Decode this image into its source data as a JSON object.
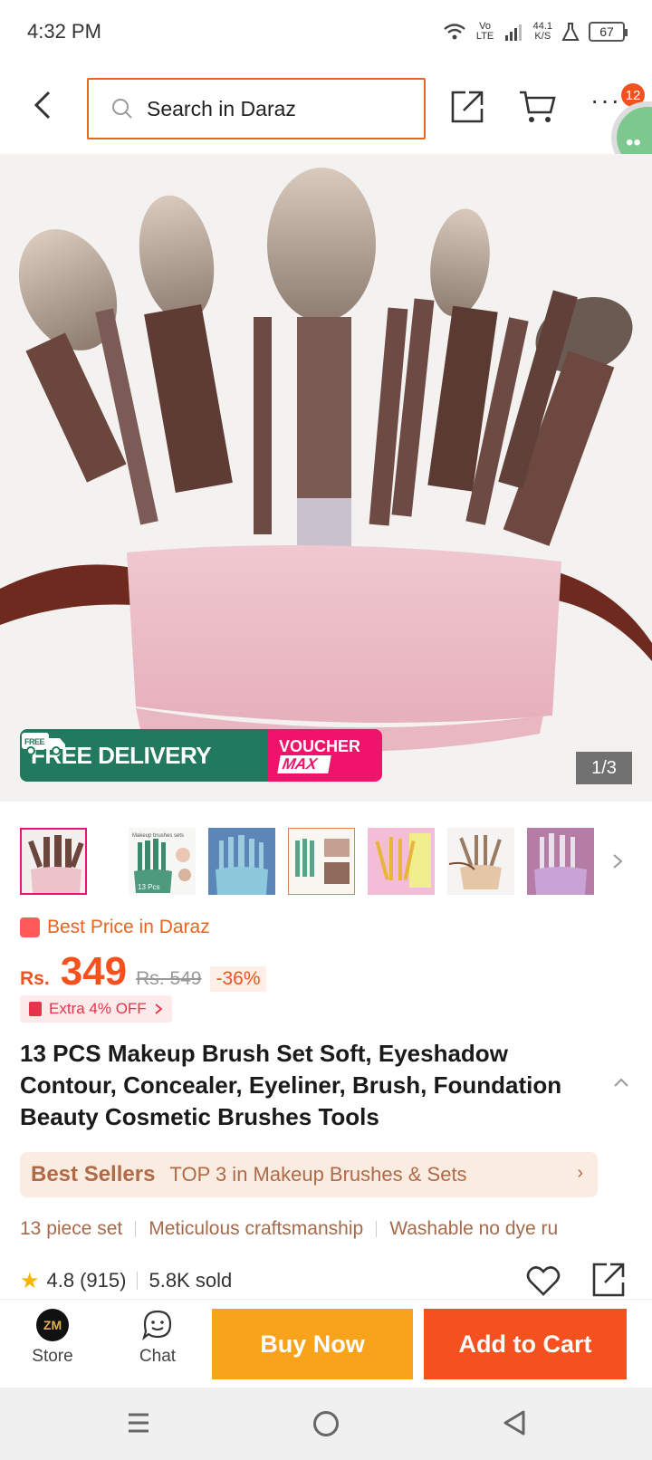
{
  "status_bar": {
    "time": "4:32 PM",
    "network_label": "Vo LTE",
    "speed": "44.1",
    "speed_unit": "K/S",
    "battery": "67"
  },
  "top_nav": {
    "search_placeholder": "Search in Daraz",
    "cart_badge": "12",
    "more_label": "···"
  },
  "hero": {
    "promo_free": "FREE DELIVERY",
    "promo_free_tag": "FREE",
    "promo_voucher": "VOUCHER",
    "promo_voucher_max": "MAX",
    "page_indicator": "1/3"
  },
  "thumbnails": {
    "count": 7,
    "active_index": 0,
    "thumb_2_caption": "Makeup brushes sets",
    "thumb_2_badge": "13 Pcs"
  },
  "price": {
    "best_price_label": "Best Price in Daraz",
    "currency": "Rs.",
    "current": "349",
    "original": "Rs. 549",
    "discount": "-36%",
    "extra_off": "Extra 4% OFF"
  },
  "product": {
    "title": "13 PCS Makeup Brush Set Soft, Eyeshadow Contour, Concealer, Eyeliner, Brush, Foundation Beauty Cosmetic Brushes Tools"
  },
  "best_sellers": {
    "label": "Best Sellers",
    "text": "TOP 3 in Makeup Brushes & Sets"
  },
  "features": [
    "13 piece set",
    "Meticulous craftsmanship",
    "Washable no dye ru"
  ],
  "rating": {
    "score": "4.8",
    "count": "(915)",
    "sold": "5.8K sold"
  },
  "bottom_bar": {
    "store_label": "Store",
    "store_logo": "ZM",
    "chat_label": "Chat",
    "buy_now": "Buy Now",
    "add_to_cart": "Add to Cart"
  },
  "colors": {
    "accent_orange": "#f5511e",
    "buy_yellow": "#f9a21b",
    "free_green": "#227a5e",
    "voucher_pink": "#f0136b"
  }
}
